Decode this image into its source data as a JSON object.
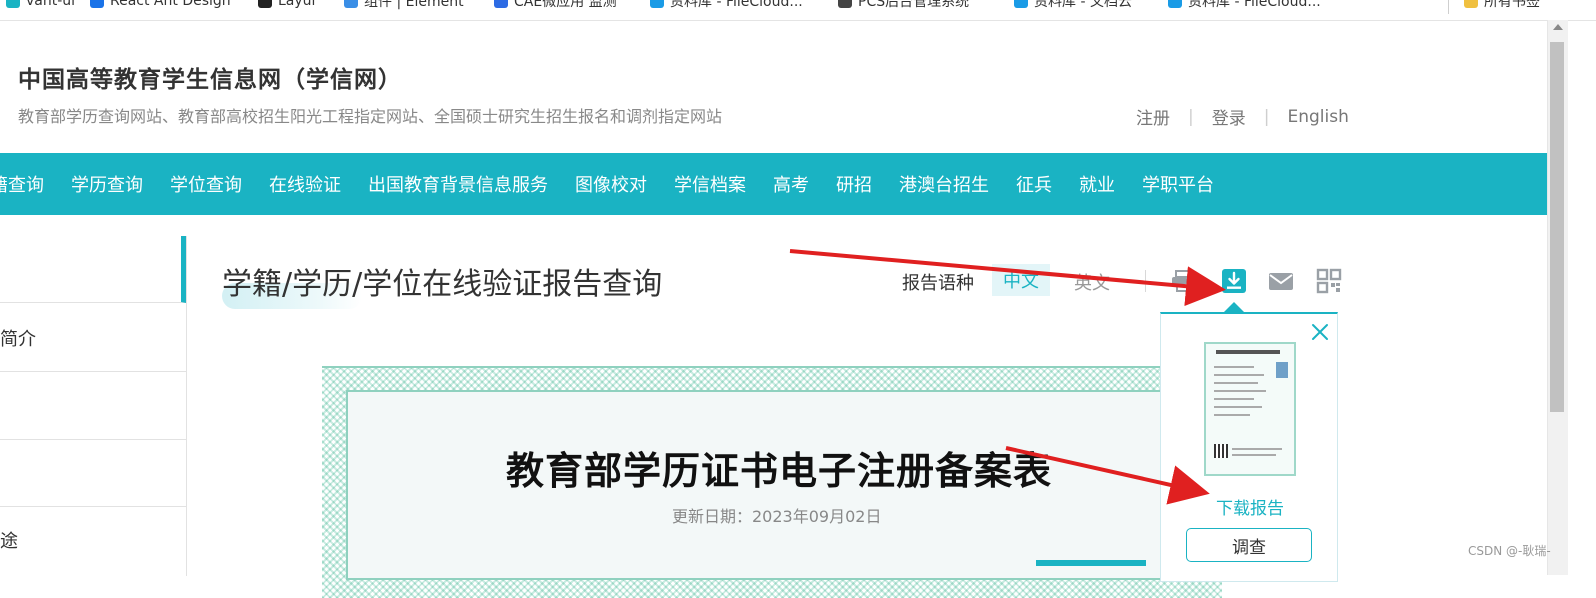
{
  "bookmarks": [
    {
      "label": "vant-ui",
      "color": "#1ab3c3"
    },
    {
      "label": "React Ant Design",
      "color": "#1a73e8"
    },
    {
      "label": "Layui",
      "color": "#222222"
    },
    {
      "label": "组件 | Element",
      "color": "#3a8ee6"
    },
    {
      "label": "CAE微应用 监测",
      "color": "#2d6be4"
    },
    {
      "label": "资料库 - FileCloud...",
      "color": "#1a9be6"
    },
    {
      "label": "PCS后台管理系统",
      "color": "#444444"
    },
    {
      "label": "资料库 - 文档云",
      "color": "#1a9be6"
    },
    {
      "label": "资料库 - FileCloud...",
      "color": "#1a9be6"
    },
    {
      "label": "所有书签",
      "color": "#f0c040"
    }
  ],
  "header": {
    "title": "中国高等教育学生信息网（学信网）",
    "subtitle": "教育部学历查询网站、教育部高校招生阳光工程指定网站、全国硕士研究生招生报名和调剂指定网站",
    "links": [
      "注册",
      "登录",
      "English"
    ]
  },
  "nav": [
    "籍查询",
    "学历查询",
    "学位查询",
    "在线验证",
    "出国教育背景信息服务",
    "图像校对",
    "学信档案",
    "高考",
    "研招",
    "港澳台招生",
    "征兵",
    "就业",
    "学职平台"
  ],
  "sidebar": [
    "",
    "简介",
    "",
    "",
    "途"
  ],
  "content": {
    "heading": "学籍/学历/学位在线验证报告查询",
    "lang_label": "报告语种",
    "lang_cn": "中文",
    "lang_en": "英文",
    "tools": [
      "print-icon",
      "download-icon",
      "mail-icon",
      "qrcode-icon"
    ]
  },
  "certificate": {
    "title": "教育部学历证书电子注册备案表",
    "date": "更新日期：2023年09月02日"
  },
  "popup": {
    "download_label": "下载报告",
    "survey_label": "调查"
  },
  "watermark": "CSDN @-耿瑞-",
  "colors": {
    "accent": "#1ab3c3",
    "arrow": "#e02020"
  }
}
